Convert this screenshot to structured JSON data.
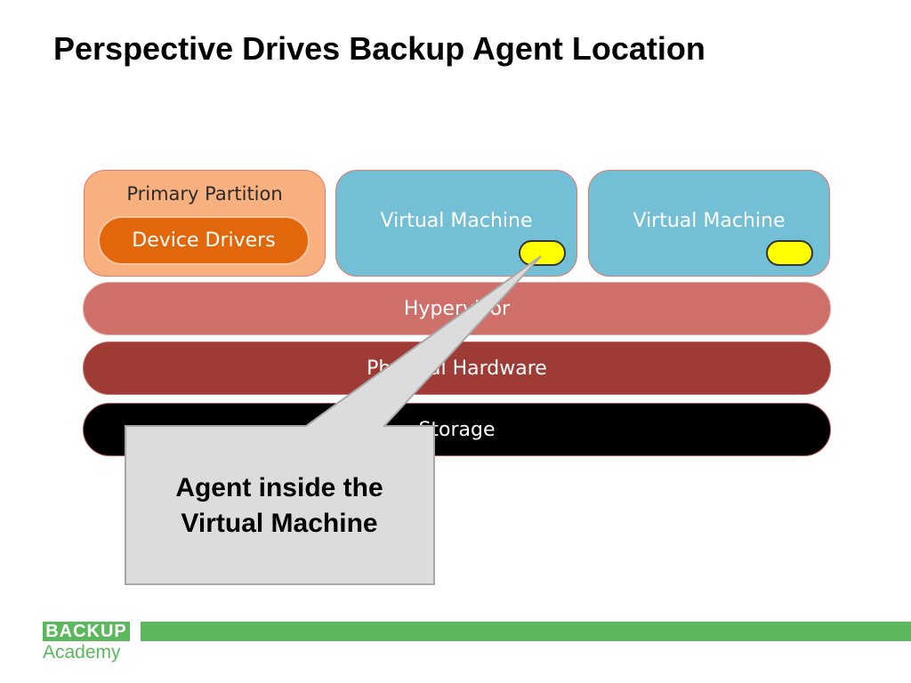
{
  "title": "Perspective Drives Backup Agent Location",
  "diagram": {
    "primary_partition": {
      "label": "Primary Partition",
      "device_drivers": "Device Drivers"
    },
    "virtual_machines": [
      "Virtual Machine",
      "Virtual Machine"
    ],
    "layers": {
      "hypervisor": "Hypervisor",
      "physical_hardware": "Physical Hardware",
      "storage": "Storage"
    },
    "callout": {
      "line1": "Agent inside the",
      "line2": "Virtual Machine"
    }
  },
  "logo": {
    "line1": "BACKUP",
    "line2": "Academy"
  },
  "colors": {
    "partition": "#f8b07e",
    "device_drivers": "#e2670b",
    "virtual_machine": "#72bfd6",
    "agent_marker": "#ffff00",
    "hypervisor": "#ce6f6a",
    "physical_hardware": "#9e3b35",
    "storage": "#000000",
    "callout": "#dcdcdc",
    "brand_green": "#5cb85c"
  }
}
